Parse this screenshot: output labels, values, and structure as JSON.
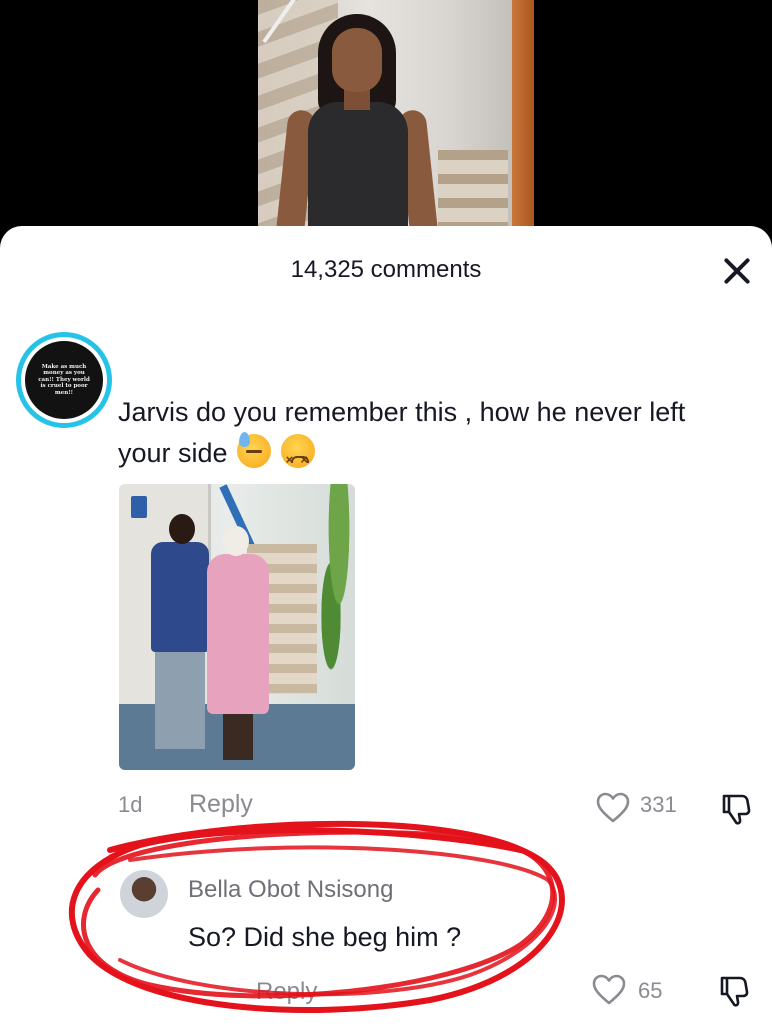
{
  "sheet": {
    "title": "14,325 comments"
  },
  "comment": {
    "avatar_text": "Make as much money as you can!! They world is cruel to poor men!!",
    "text": "Jarvis do you remember this , how he never left your side",
    "emojis": [
      "downcast-sweat-emoji",
      "confounded-emoji"
    ],
    "time": "1d",
    "reply_label": "Reply",
    "likes": "331"
  },
  "reply": {
    "author": "Bella Obot Nsisong",
    "text": "So? Did she beg him ?",
    "reply_label": "Reply",
    "likes": "65"
  },
  "colors": {
    "avatar_ring": "#25c3e8",
    "annotation": "#e3121b",
    "muted_text": "#8a8b91"
  }
}
